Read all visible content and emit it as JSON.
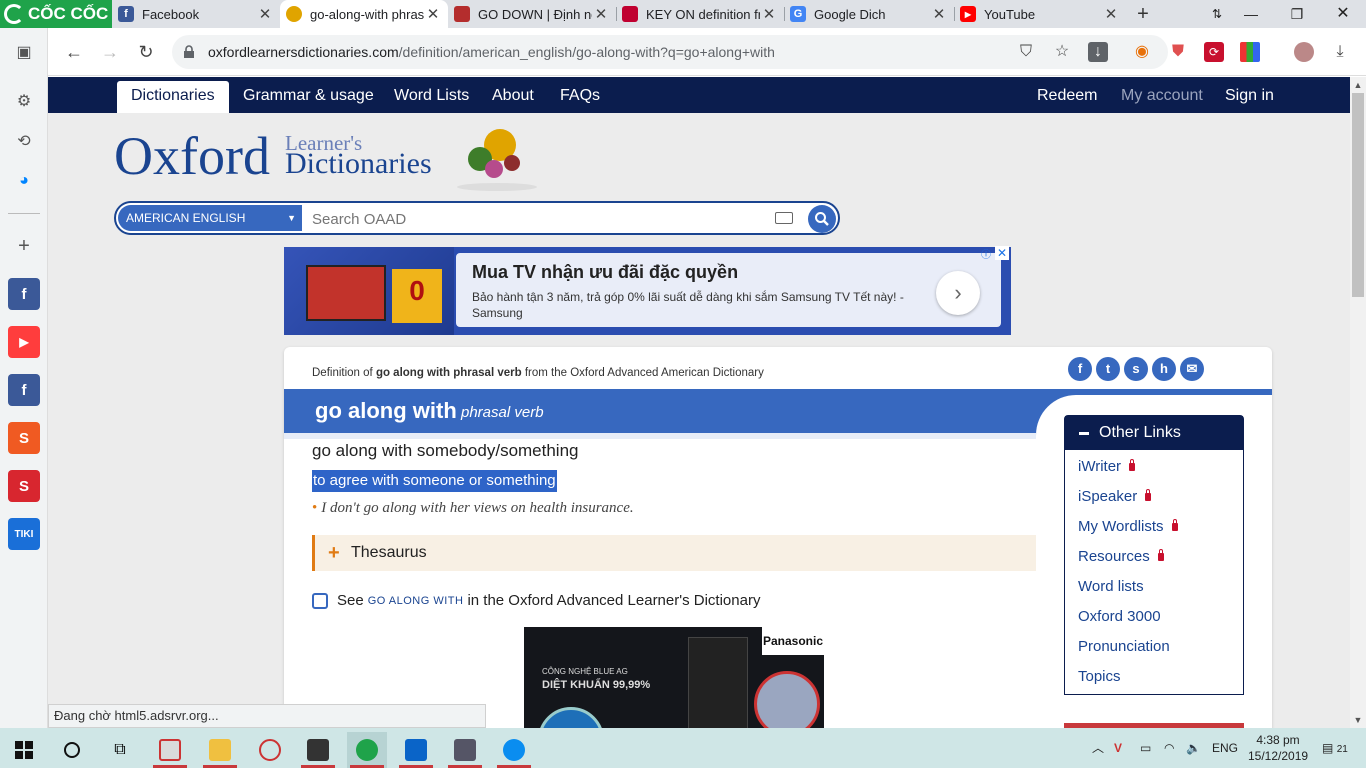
{
  "browser": {
    "brand": "CỐC CỐC",
    "tabs": [
      {
        "title": "Facebook",
        "icon": "facebook-icon",
        "color": "#3b5998"
      },
      {
        "title": "go-along-with phrasal verb",
        "icon": "oxford-icon",
        "color": "#e0a400",
        "active": true
      },
      {
        "title": "GO DOWN | Định nghĩa",
        "icon": "cambridge-icon",
        "color": "#b42d2d"
      },
      {
        "title": "KEY ON definition from",
        "icon": "collins-icon",
        "color": "#c00030"
      },
      {
        "title": "Google Dich",
        "icon": "google-translate-icon",
        "color": "#4285f4"
      },
      {
        "title": "YouTube",
        "icon": "youtube-icon",
        "color": "#ff0000"
      }
    ],
    "url_host": "oxfordlearnersdictionaries.com",
    "url_path": "/definition/american_english/go-along-with?q=go+along+with"
  },
  "nav": {
    "items": [
      "Dictionaries",
      "Grammar & usage",
      "Word Lists",
      "About",
      "FAQs"
    ],
    "right": [
      "Redeem",
      "My account",
      "Sign in"
    ]
  },
  "logo": {
    "main": "Oxford",
    "line1": "Learner's",
    "line2": "Dictionaries"
  },
  "search": {
    "dictionary": "AMERICAN ENGLISH",
    "placeholder": "Search OAAD"
  },
  "ad_top": {
    "headline": "Mua TV nhận ưu đãi đặc quyền",
    "body": "Bảo hành tận 3 năm, trả góp 0% lãi suất dễ dàng khi sắm Samsung TV Tết này! - Samsung",
    "promo": "0"
  },
  "entry": {
    "def_prefix": "Definition of",
    "def_word": "go along with phrasal verb",
    "def_suffix": "from the Oxford Advanced American Dictionary",
    "headword": "go along with",
    "pos": "phrasal verb",
    "idiom": "go along with somebody/something",
    "sense": "to agree with someone or something",
    "example": "I don't go along with her views on health insurance.",
    "thesaurus": "Thesaurus",
    "see_prefix": "See",
    "see_word": "GO ALONG WITH",
    "see_suffix": "in the Oxford Advanced Learner's Dictionary"
  },
  "social": [
    {
      "icon": "facebook-share-icon",
      "glyph": "f"
    },
    {
      "icon": "twitter-share-icon",
      "glyph": "t"
    },
    {
      "icon": "stumbleupon-share-icon",
      "glyph": "s"
    },
    {
      "icon": "hi5-share-icon",
      "glyph": "h"
    },
    {
      "icon": "email-share-icon",
      "glyph": "✉"
    }
  ],
  "other_links": {
    "title": "Other Links",
    "items": [
      {
        "label": "iWriter",
        "locked": true
      },
      {
        "label": "iSpeaker",
        "locked": true
      },
      {
        "label": "My Wordlists",
        "locked": true
      },
      {
        "label": "Resources",
        "locked": true
      },
      {
        "label": "Word lists",
        "locked": false
      },
      {
        "label": "Oxford 3000",
        "locked": false
      },
      {
        "label": "Pronunciation",
        "locked": false
      },
      {
        "label": "Topics",
        "locked": false
      }
    ]
  },
  "ad_bottom": {
    "brand": "Panasonic",
    "tagline": "CÔNG NGHỆ BLUE AG",
    "claim": "DIỆT KHUẨN 99,99%"
  },
  "status_text": "Đang chờ html5.adsrvr.org...",
  "taskbar": {
    "lang": "ENG",
    "time": "4:38 pm",
    "date": "15/12/2019",
    "notifications": "21"
  },
  "colors": {
    "oxford_navy": "#0b1d4e",
    "oxford_blue": "#3768bf",
    "accent_orange": "#e07b14",
    "lock_red": "#c8102e"
  }
}
